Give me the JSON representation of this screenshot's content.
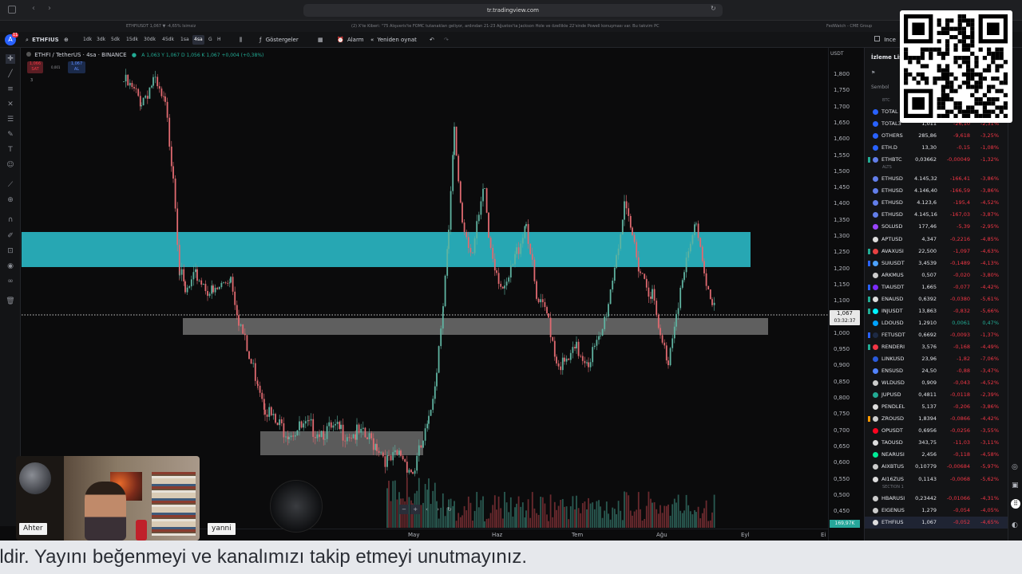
{
  "browser": {
    "url": "tr.tradingview.com",
    "tabs": [
      "ETHFIUSDT 1,067 ▼ -4,65% Isimsiz",
      "(2) X'te Kiberi: \"75 Alışveris'te FOMC tutanakları geliyor, ardından 21-23 Ağustos'ta Jackson Hole ve özellikle 22'sinde Powell konuşması var. Bu takvim PC",
      "FedWatch - CME Group"
    ]
  },
  "toolbar": {
    "symbol": "ETHFIUS",
    "timeframes": [
      "1dk",
      "3dk",
      "5dk",
      "15dk",
      "30dk",
      "45dk",
      "1sa",
      "4sa",
      "G",
      "H"
    ],
    "active_timeframe": "4sa",
    "indicators_label": "Göstergeler",
    "alarm_label": "Alarm",
    "replay_label": "Yeniden oynat",
    "account_initial": "A",
    "notif_count": "11",
    "compare_label": "Ince"
  },
  "chart": {
    "title": "ETHFI / TetherUS · 4sa · BINANCE",
    "ohlc": "A 1,063  Y 1,067  D 1,056  K 1,067  +0,004 (+0,38%)",
    "sell_price": "1,066",
    "sell_label": "SAT",
    "spread": "0,001",
    "buy_price": "1,067",
    "buy_label": "AL",
    "indicator_count": "3",
    "currency": "USDT",
    "price_labels": [
      "1,800",
      "1,750",
      "1,700",
      "1,650",
      "1,600",
      "1,550",
      "1,500",
      "1,450",
      "1,400",
      "1,350",
      "1,300",
      "1,250",
      "1,200",
      "1,150",
      "1,100",
      "1,050",
      "1,000",
      "0,950",
      "0,900",
      "0,850",
      "0,800",
      "0,750",
      "0,700",
      "0,650",
      "0,600",
      "0,550",
      "0,500",
      "0,450"
    ],
    "current_price": "1,067",
    "countdown": "03:32:37",
    "volume_label": "169,97K",
    "x_labels": [
      "May",
      "Haz",
      "Tem",
      "Ağu",
      "Eyl"
    ]
  },
  "watchlist": {
    "title": "İzleme Listesi",
    "col_symbol": "Sembol",
    "sections": [
      "BTC",
      "ALTS",
      "SECTION 1"
    ],
    "rows": [
      {
        "sym": "TOTAL",
        "last": "",
        "chg": "",
        "pct": "",
        "dir": "neg",
        "dot": "#2962ff",
        "flag": ""
      },
      {
        "sym": "TOTAL3",
        "last": "1,011",
        "chg": "-26,10",
        "pct": "-2,31%",
        "dir": "neg",
        "dot": "#2962ff",
        "flag": ""
      },
      {
        "sym": "OTHERS",
        "last": "285,86",
        "chg": "-9,618",
        "pct": "-3,25%",
        "dir": "neg",
        "dot": "#2962ff",
        "flag": ""
      },
      {
        "sym": "ETH.D",
        "last": "13,30",
        "chg": "-0,15",
        "pct": "-1,08%",
        "dir": "neg",
        "dot": "#2962ff",
        "flag": ""
      },
      {
        "sym": "ETHBTC",
        "last": "0,03662",
        "chg": "-0,00049",
        "pct": "-1,32%",
        "dir": "neg",
        "dot": "#627eea",
        "flag": "#22ab94"
      },
      {
        "sym": "ETHUSD",
        "last": "4.145,32",
        "chg": "-166,41",
        "pct": "-3,86%",
        "dir": "neg",
        "dot": "#627eea",
        "flag": ""
      },
      {
        "sym": "ETHUSD",
        "last": "4.146,40",
        "chg": "-166,59",
        "pct": "-3,86%",
        "dir": "neg",
        "dot": "#627eea",
        "flag": ""
      },
      {
        "sym": "ETHUSD",
        "last": "4.123,6",
        "chg": "-195,4",
        "pct": "-4,52%",
        "dir": "neg",
        "dot": "#627eea",
        "flag": ""
      },
      {
        "sym": "ETHUSD",
        "last": "4.145,16",
        "chg": "-167,03",
        "pct": "-3,87%",
        "dir": "neg",
        "dot": "#627eea",
        "flag": ""
      },
      {
        "sym": "SOLUSD",
        "last": "177,46",
        "chg": "-5,39",
        "pct": "-2,95%",
        "dir": "neg",
        "dot": "#9945ff",
        "flag": ""
      },
      {
        "sym": "APTUSD",
        "last": "4,347",
        "chg": "-0,2216",
        "pct": "-4,85%",
        "dir": "neg",
        "dot": "#dddddd",
        "flag": ""
      },
      {
        "sym": "AVAXUSI",
        "last": "22,500",
        "chg": "-1,097",
        "pct": "-4,63%",
        "dir": "neg",
        "dot": "#e84142",
        "flag": "#22ab94"
      },
      {
        "sym": "SUIUSDT",
        "last": "3,4539",
        "chg": "-0,1489",
        "pct": "-4,13%",
        "dir": "neg",
        "dot": "#4da2ff",
        "flag": "#2962ff"
      },
      {
        "sym": "ARKMUS",
        "last": "0,507",
        "chg": "-0,020",
        "pct": "-3,80%",
        "dir": "neg",
        "dot": "#cccccc",
        "flag": ""
      },
      {
        "sym": "TIAUSDT",
        "last": "1,665",
        "chg": "-0,077",
        "pct": "-4,42%",
        "dir": "neg",
        "dot": "#7b2bf9",
        "flag": "#2962ff"
      },
      {
        "sym": "ENAUSD",
        "last": "0,6392",
        "chg": "-0,0380",
        "pct": "-5,61%",
        "dir": "neg",
        "dot": "#dddddd",
        "flag": "#22ab94"
      },
      {
        "sym": "INJUSDT",
        "last": "13,863",
        "chg": "-0,832",
        "pct": "-5,66%",
        "dir": "neg",
        "dot": "#00f2fe",
        "flag": "#22ab94"
      },
      {
        "sym": "LDOUSD",
        "last": "1,2910",
        "chg": "0,0061",
        "pct": "0,47%",
        "dir": "pos",
        "dot": "#00a3ff",
        "flag": ""
      },
      {
        "sym": "FETUSDT",
        "last": "0,6692",
        "chg": "-0,0093",
        "pct": "-1,37%",
        "dir": "neg",
        "dot": "#1d2a44",
        "flag": "#2962ff"
      },
      {
        "sym": "RENDERI",
        "last": "3,576",
        "chg": "-0,168",
        "pct": "-4,49%",
        "dir": "neg",
        "dot": "#f23645",
        "flag": "#22ab94"
      },
      {
        "sym": "LINKUSD",
        "last": "23,96",
        "chg": "-1,82",
        "pct": "-7,06%",
        "dir": "neg",
        "dot": "#2a5ada",
        "flag": ""
      },
      {
        "sym": "ENSUSD",
        "last": "24,50",
        "chg": "-0,88",
        "pct": "-3,47%",
        "dir": "neg",
        "dot": "#5284ff",
        "flag": ""
      },
      {
        "sym": "WLDUSD",
        "last": "0,909",
        "chg": "-0,043",
        "pct": "-4,52%",
        "dir": "neg",
        "dot": "#cccccc",
        "flag": ""
      },
      {
        "sym": "JUPUSD",
        "last": "0,4811",
        "chg": "-0,0118",
        "pct": "-2,39%",
        "dir": "neg",
        "dot": "#22ab94",
        "flag": ""
      },
      {
        "sym": "PENDLEL",
        "last": "5,137",
        "chg": "-0,206",
        "pct": "-3,86%",
        "dir": "neg",
        "dot": "#dddddd",
        "flag": ""
      },
      {
        "sym": "ZROUSD",
        "last": "1,8394",
        "chg": "-0,0866",
        "pct": "-4,42%",
        "dir": "neg",
        "dot": "#cccccc",
        "flag": "#ff9800"
      },
      {
        "sym": "OPUSDT",
        "last": "0,6956",
        "chg": "-0,0256",
        "pct": "-3,55%",
        "dir": "neg",
        "dot": "#ff0420",
        "flag": ""
      },
      {
        "sym": "TAOUSD",
        "last": "343,75",
        "chg": "-11,03",
        "pct": "-3,11%",
        "dir": "neg",
        "dot": "#dddddd",
        "flag": ""
      },
      {
        "sym": "NEARUSI",
        "last": "2,456",
        "chg": "-0,118",
        "pct": "-4,58%",
        "dir": "neg",
        "dot": "#00ec97",
        "flag": ""
      },
      {
        "sym": "AIXBTUS",
        "last": "0,10779",
        "chg": "-0,00684",
        "pct": "-5,97%",
        "dir": "neg",
        "dot": "#cccccc",
        "flag": ""
      },
      {
        "sym": "AI16ZUS",
        "last": "0,1143",
        "chg": "-0,0068",
        "pct": "-5,62%",
        "dir": "neg",
        "dot": "#dddddd",
        "flag": ""
      },
      {
        "sym": "HBARUSI",
        "last": "0,23442",
        "chg": "-0,01066",
        "pct": "-4,31%",
        "dir": "neg",
        "dot": "#cccccc",
        "flag": ""
      },
      {
        "sym": "EIGENUS",
        "last": "1,279",
        "chg": "-0,054",
        "pct": "-4,05%",
        "dir": "neg",
        "dot": "#cccccc",
        "flag": ""
      },
      {
        "sym": "ETHFIUS",
        "last": "1,067",
        "chg": "-0,052",
        "pct": "-4,65%",
        "dir": "neg",
        "dot": "#dddddd",
        "flag": ""
      }
    ]
  },
  "stream": {
    "host1": "Ahter",
    "host2": "yanni",
    "ticker": "ildir. Yayını beğenmeyi ve kanalımızı takip etmeyi unutmayınız."
  },
  "colors": {
    "resistance_zone": "#27a7b3",
    "support_zone": "#7a7a7a",
    "candle_up": "#5fb3a1",
    "candle_down": "#e06a70"
  }
}
